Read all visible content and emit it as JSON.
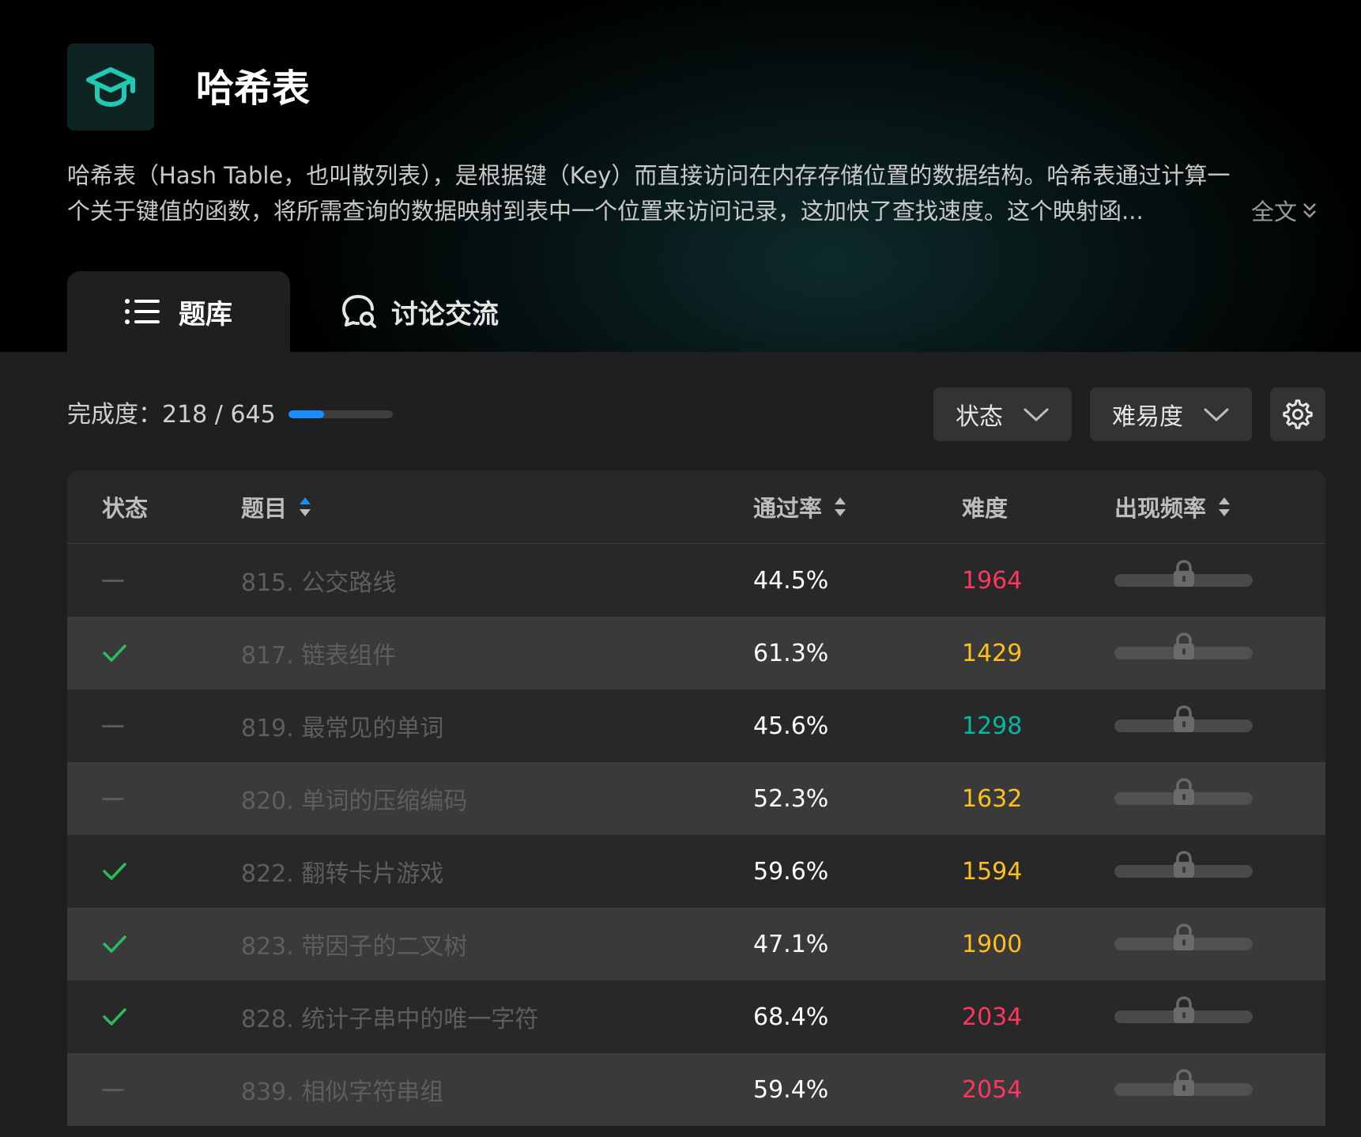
{
  "header": {
    "title": "哈希表",
    "description_line1": "哈希表（Hash Table，也叫散列表），是根据键（Key）而直接访问在内存存储位置的数据结构。哈希表通过计算一",
    "description_line2": "个关于键值的函数，将所需查询的数据映射到表中一个位置来访问记录，这加快了查找速度。这个映射函...",
    "expand_label": "全文",
    "logo_icon": "graduation-cap-icon"
  },
  "tabs": [
    {
      "label": "题库",
      "icon": "list-icon",
      "active": true
    },
    {
      "label": "讨论交流",
      "icon": "chat-search-icon",
      "active": false
    }
  ],
  "toolbar": {
    "progress_label": "完成度：",
    "progress_value": "218 / 645",
    "progress_fraction": 0.338,
    "status_filter": "状态",
    "difficulty_filter": "难易度",
    "settings_icon": "gear-icon"
  },
  "table": {
    "columns": {
      "status": "状态",
      "title": "题目",
      "pass_rate": "通过率",
      "difficulty": "难度",
      "frequency": "出现频率"
    },
    "rows": [
      {
        "status": "todo",
        "title": "815. 公交路线",
        "pass_rate": "44.5%",
        "difficulty": "1964",
        "difficulty_color": "#ff375f"
      },
      {
        "status": "done",
        "title": "817. 链表组件",
        "pass_rate": "61.3%",
        "difficulty": "1429",
        "difficulty_color": "#ffc01e"
      },
      {
        "status": "todo",
        "title": "819. 最常见的单词",
        "pass_rate": "45.6%",
        "difficulty": "1298",
        "difficulty_color": "#00b8a3"
      },
      {
        "status": "todo",
        "title": "820. 单词的压缩编码",
        "pass_rate": "52.3%",
        "difficulty": "1632",
        "difficulty_color": "#ffc01e"
      },
      {
        "status": "done",
        "title": "822. 翻转卡片游戏",
        "pass_rate": "59.6%",
        "difficulty": "1594",
        "difficulty_color": "#ffc01e"
      },
      {
        "status": "done",
        "title": "823. 带因子的二叉树",
        "pass_rate": "47.1%",
        "difficulty": "1900",
        "difficulty_color": "#ffc01e"
      },
      {
        "status": "done",
        "title": "828. 统计子串中的唯一字符",
        "pass_rate": "68.4%",
        "difficulty": "2034",
        "difficulty_color": "#ff375f"
      },
      {
        "status": "todo",
        "title": "839. 相似字符串组",
        "pass_rate": "59.4%",
        "difficulty": "2054",
        "difficulty_color": "#ff375f"
      }
    ]
  },
  "colors": {
    "accent_blue": "#1a8cff",
    "check_green": "#2cbb5d",
    "brand_teal": "#1fc9b4"
  }
}
